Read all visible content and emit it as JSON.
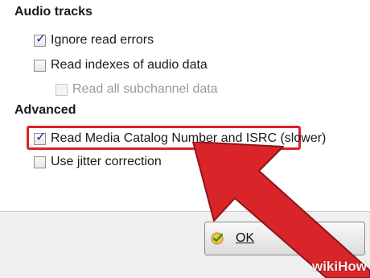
{
  "sections": {
    "audio_tracks": {
      "title": "Audio tracks",
      "options": [
        {
          "label": "Ignore read errors",
          "checked": true,
          "enabled": true
        },
        {
          "label": "Read indexes of audio data",
          "checked": false,
          "enabled": true
        },
        {
          "label": "Read all subchannel data",
          "checked": false,
          "enabled": false
        }
      ]
    },
    "advanced": {
      "title": "Advanced",
      "options": [
        {
          "label": "Read Media Catalog Number and ISRC (slower)",
          "checked": true,
          "enabled": true,
          "highlighted": true
        },
        {
          "label": "Use jitter correction",
          "checked": false,
          "enabled": true
        }
      ]
    }
  },
  "buttons": {
    "ok_label": "OK",
    "ok_icon": "ok-check-icon"
  },
  "watermark": {
    "text": "wikiHow"
  },
  "colors": {
    "highlight": "#d9252a",
    "arrow": "#d9252a",
    "checkmark": "#21308a"
  }
}
